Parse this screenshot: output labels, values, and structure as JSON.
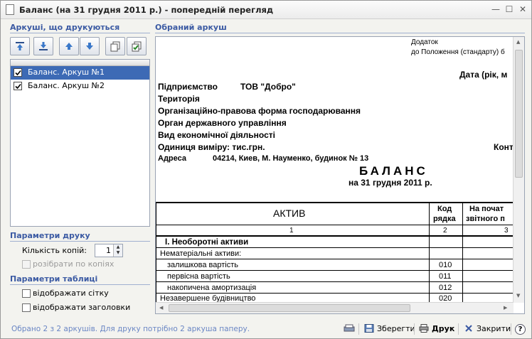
{
  "window": {
    "title": "Баланс (на 31 грудня 2011 р.) - попередній перегляд",
    "minimize_glyph": "—",
    "restore_glyph": "☐",
    "close_glyph": "✕"
  },
  "left_panel": {
    "sheets_header": "Аркуші, що друкуються",
    "toolbar_icons": [
      "move-to-top-icon",
      "move-to-bottom-icon",
      "move-up-icon",
      "move-down-icon",
      "copy-icon",
      "select-all-icon"
    ],
    "sheets": [
      {
        "label": "Баланс. Аркуш №1",
        "checked": true,
        "selected": true
      },
      {
        "label": "Баланс. Аркуш №2",
        "checked": true,
        "selected": false
      }
    ],
    "print_params_header": "Параметри друку",
    "copies_label": "Кількість копій:",
    "copies_value": "1",
    "collate_label": "розібрати по копіях",
    "table_params_header": "Параметри таблиці",
    "show_grid_label": "відображати сітку",
    "show_headers_label": "відображати заголовки"
  },
  "preview": {
    "header": "Обраний аркуш",
    "addendum": "Додаток",
    "addendum_sub": "до Положення (стандарту) б",
    "date_label": "Дата (рік, м",
    "enterprise_label": "Підприємство",
    "enterprise_value": "ТОВ \"Добро\"",
    "territory": "Територія",
    "org_form": "Організаційно-правова форма господарювання",
    "gov_body": "Орган державного управління",
    "activity": "Вид економічної діяльності",
    "unit": "Одиниця виміру: тис.грн.",
    "cont": "Конт",
    "address_label": "Адреса",
    "address_value": "04214, Киев, М. Науменко, будинок № 13",
    "doc_title": "БАЛАНС",
    "doc_date": "на 31 грудня 2011 р.",
    "table": {
      "col_asset": "АКТИВ",
      "col_code_1": "Код",
      "col_code_2": "рядка",
      "col_begin_1": "На почат",
      "col_begin_2": "звітного п",
      "num_1": "1",
      "num_2": "2",
      "num_3": "3",
      "rows": [
        {
          "label": "I. Необоротні  активи",
          "code": "",
          "bold": true
        },
        {
          "label": "Нематеріальні активи:",
          "code": "",
          "bold": false
        },
        {
          "label": "залишкова вартість",
          "code": "010",
          "bold": false
        },
        {
          "label": "первісна вартість",
          "code": "011",
          "bold": false
        },
        {
          "label": "накопичена амортизація",
          "code": "012",
          "bold": false
        },
        {
          "label": "Незавершене будівництво",
          "code": "020",
          "bold": false
        }
      ]
    }
  },
  "status": {
    "text": "Обрано 2 з 2 аркушів. Для друку потрібно 2 аркуша паперу.",
    "save_label": "Зберегти",
    "print_label": "Друк",
    "close_label": "Закрити",
    "help_glyph": "?"
  }
}
